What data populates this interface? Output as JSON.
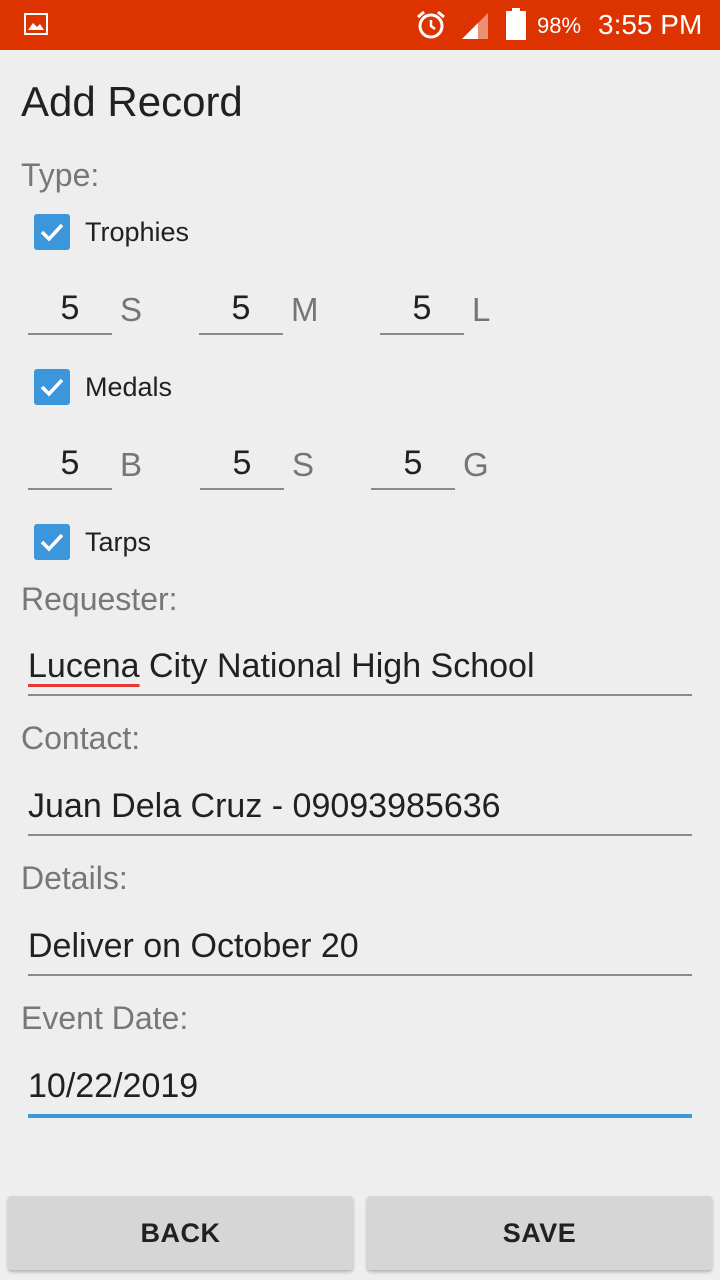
{
  "status_bar": {
    "battery_percent": "98%",
    "time": "3:55 PM",
    "icons": [
      "gallery-icon",
      "alarm-icon",
      "signal-icon",
      "battery-icon"
    ],
    "color": "#dd3300"
  },
  "title": "Add Record",
  "type_label": "Type:",
  "trophies": {
    "label": "Trophies",
    "checked": true,
    "fields": [
      {
        "value": "5",
        "unit": "S"
      },
      {
        "value": "5",
        "unit": "M"
      },
      {
        "value": "5",
        "unit": "L"
      }
    ]
  },
  "medals": {
    "label": "Medals",
    "checked": true,
    "fields": [
      {
        "value": "5",
        "unit": "B"
      },
      {
        "value": "5",
        "unit": "S"
      },
      {
        "value": "5",
        "unit": "G"
      }
    ]
  },
  "tarps": {
    "label": "Tarps",
    "checked": true
  },
  "requester": {
    "label": "Requester:",
    "value_misspelled": "Lucena",
    "value_rest": " City National High School"
  },
  "contact": {
    "label": "Contact:",
    "value": "Juan Dela Cruz - 09093985636"
  },
  "details": {
    "label": "Details:",
    "value": "Deliver on October 20"
  },
  "event_date": {
    "label": "Event Date:",
    "value": "10/22/2019"
  },
  "buttons": {
    "back": "BACK",
    "save": "SAVE"
  },
  "accent_color": "#3b96dc"
}
